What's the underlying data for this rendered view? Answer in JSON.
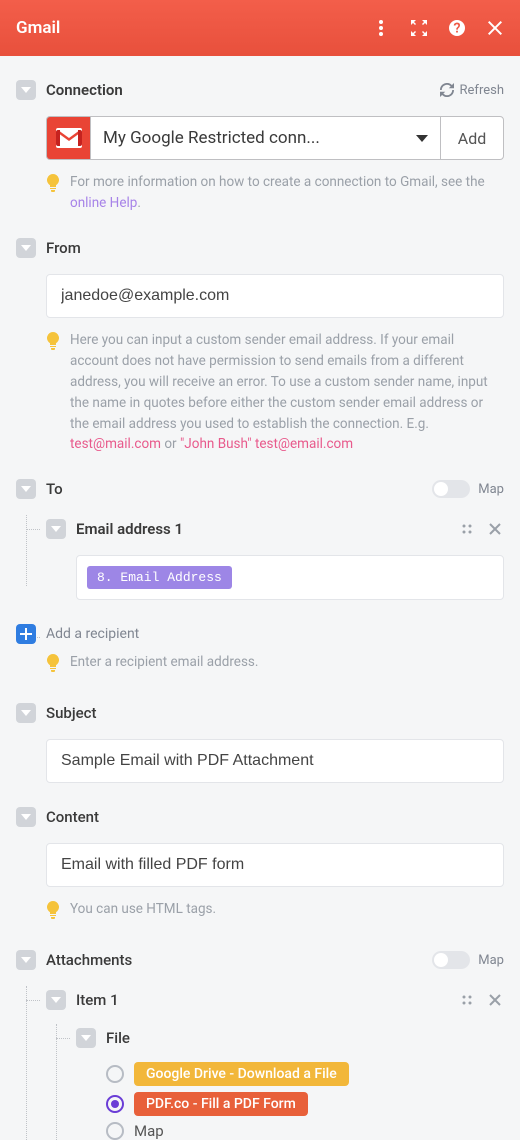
{
  "header": {
    "title": "Gmail"
  },
  "connection": {
    "label": "Connection",
    "refresh_label": "Refresh",
    "selected": "My Google Restricted conn...",
    "add_label": "Add",
    "hint_prefix": "For more information on how to create a connection to Gmail, see the ",
    "hint_link": "online Help",
    "hint_suffix": "."
  },
  "from": {
    "label": "From",
    "value": "janedoe@example.com",
    "hint_main": "Here you can input a custom sender email address. If your email account does not have permission to send emails from a different address, you will receive an error. To use a custom sender name, input the name in quotes before either the custom sender email address or the email address you used to establish the connection. E.g. ",
    "hint_ex1": "test@mail.com",
    "hint_or": " or ",
    "hint_ex2": "\"John Bush\" test@email.com"
  },
  "to": {
    "label": "To",
    "map_label": "Map",
    "item1_label": "Email address 1",
    "token": "8. Email Address",
    "add_label": "Add a recipient",
    "hint": "Enter a recipient email address."
  },
  "subject": {
    "label": "Subject",
    "value": "Sample Email with PDF Attachment"
  },
  "content": {
    "label": "Content",
    "value": "Email with filled PDF form",
    "hint": "You can use HTML tags."
  },
  "attachments": {
    "label": "Attachments",
    "map_label": "Map",
    "item1_label": "Item 1",
    "file_label": "File",
    "opt1": "Google Drive - Download a File",
    "opt2": "PDF.co - Fill a PDF Form",
    "opt3": "Map"
  }
}
